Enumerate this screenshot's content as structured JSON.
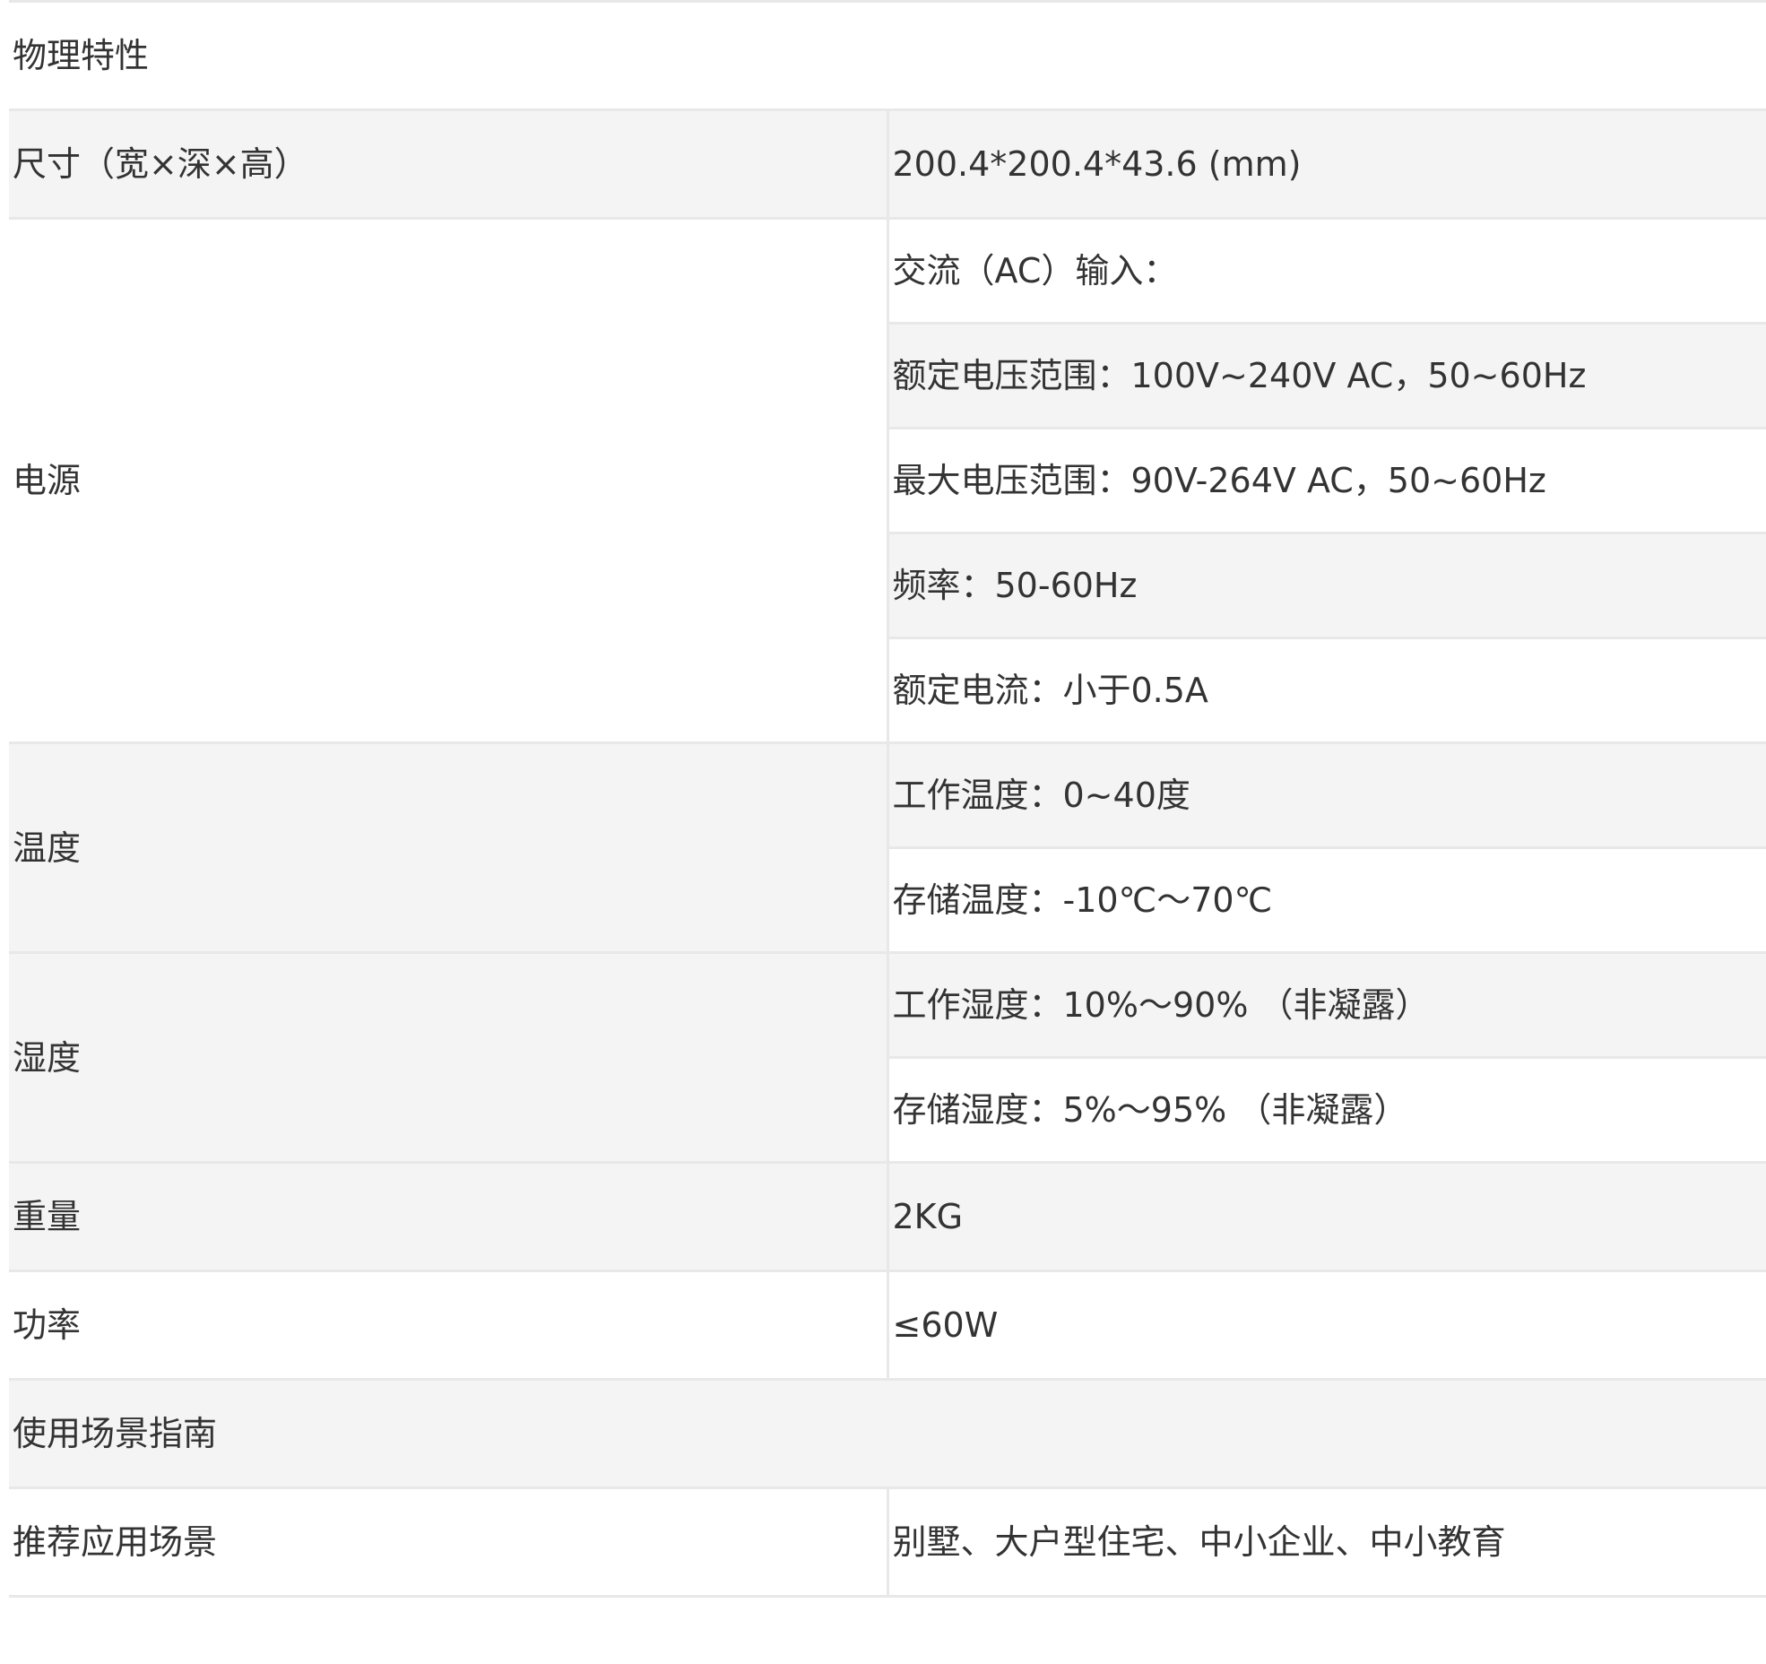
{
  "table": {
    "sections": {
      "physical": "物理特性",
      "scenario": "使用场景指南"
    },
    "dimensions": {
      "label": "尺寸（宽×深×高）",
      "value": "200.4*200.4*43.6 (mm)"
    },
    "power_supply": {
      "label": "电源",
      "values": [
        "交流（AC）输入：",
        "额定电压范围：100V~240V AC，50~60Hz",
        "最大电压范围：90V-264V AC，50~60Hz",
        "频率：50-60Hz",
        "额定电流：小于0.5A"
      ]
    },
    "temperature": {
      "label": "温度",
      "values": [
        "工作温度：0~40度",
        "存储温度：-10℃～70℃"
      ]
    },
    "humidity": {
      "label": "湿度",
      "values": [
        "工作湿度：10%～90% （非凝露）",
        "存储湿度：5%～95% （非凝露）"
      ]
    },
    "weight": {
      "label": "重量",
      "value": "2KG"
    },
    "power": {
      "label": "功率",
      "value": "≤60W"
    },
    "recommended": {
      "label": "推荐应用场景",
      "value": "别墅、大户型住宅、中小企业、中小教育"
    }
  }
}
